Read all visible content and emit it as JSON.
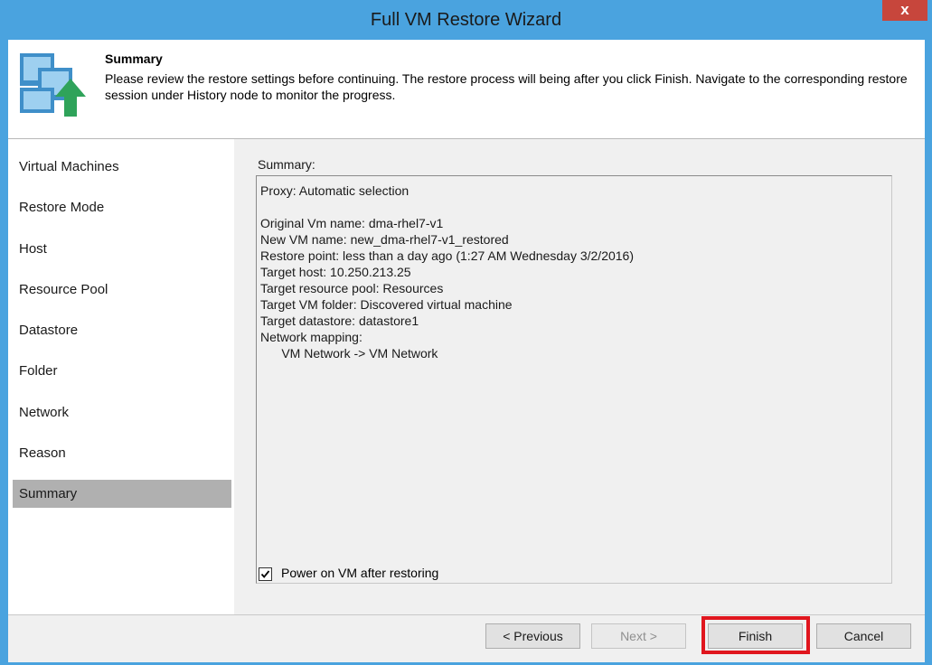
{
  "window": {
    "title": "Full VM Restore Wizard",
    "close_label": "x"
  },
  "header": {
    "title": "Summary",
    "description": "Please review the restore settings before continuing. The restore process will being after you click Finish. Navigate to the corresponding restore session under History node to monitor the progress.",
    "icon": "vm-restore-icon"
  },
  "nav": {
    "items": [
      {
        "label": "Virtual Machines"
      },
      {
        "label": "Restore Mode"
      },
      {
        "label": "Host"
      },
      {
        "label": "Resource Pool"
      },
      {
        "label": "Datastore"
      },
      {
        "label": "Folder"
      },
      {
        "label": "Network"
      },
      {
        "label": "Reason"
      },
      {
        "label": "Summary"
      }
    ],
    "active": "Summary"
  },
  "summary": {
    "label": "Summary:",
    "lines": [
      "Proxy: Automatic selection",
      "",
      "Original Vm name: dma-rhel7-v1",
      "New VM name: new_dma-rhel7-v1_restored",
      "Restore point: less than a day ago (1:27 AM Wednesday 3/2/2016)",
      "Target host: 10.250.213.25",
      "Target resource pool: Resources",
      "Target VM folder: Discovered virtual machine",
      "Target datastore: datastore1",
      "Network mapping:",
      "      VM Network -> VM Network"
    ]
  },
  "power_on": {
    "label": "Power on VM after restoring",
    "checked": true
  },
  "buttons": {
    "previous": "< Previous",
    "next": "Next >",
    "finish": "Finish",
    "cancel": "Cancel"
  },
  "colors": {
    "frame": "#4aa3df",
    "close": "#c7463c",
    "active_nav": "#b0b0b0",
    "highlight": "#e0161e"
  }
}
